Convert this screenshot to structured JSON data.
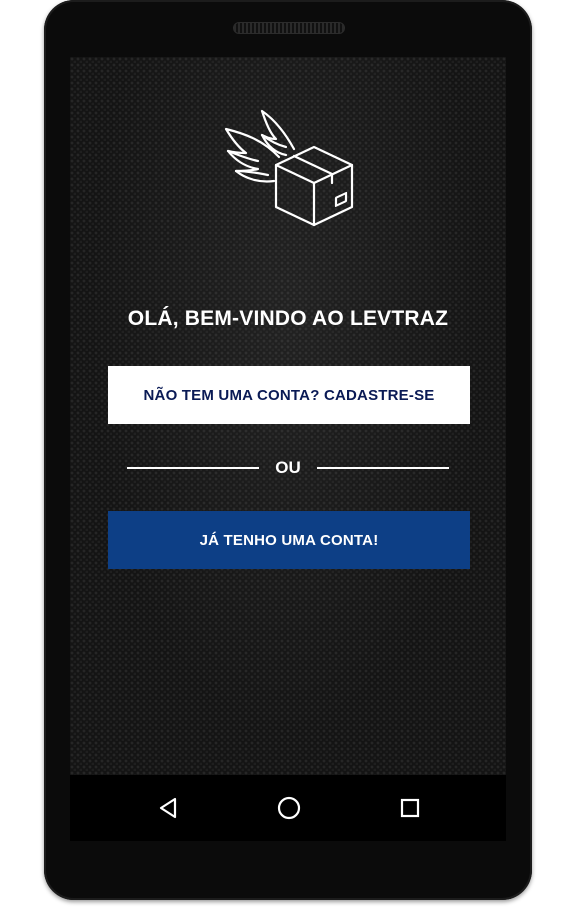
{
  "welcome": {
    "title": "OLÁ, BEM-VINDO AO LEVTRAZ"
  },
  "buttons": {
    "signup_label": "NÃO TEM UMA CONTA? CADASTRE-SE",
    "login_label": "JÁ TENHO UMA CONTA!"
  },
  "divider": {
    "text": "OU"
  },
  "logo": {
    "icon": "winged-box-icon"
  },
  "navigation": {
    "back_icon": "back-triangle-icon",
    "home_icon": "home-circle-icon",
    "recents_icon": "recents-square-icon"
  },
  "colors": {
    "primary_button_bg": "#0d3f86",
    "secondary_button_text": "#0a1a55",
    "screen_bg": "#141414"
  }
}
